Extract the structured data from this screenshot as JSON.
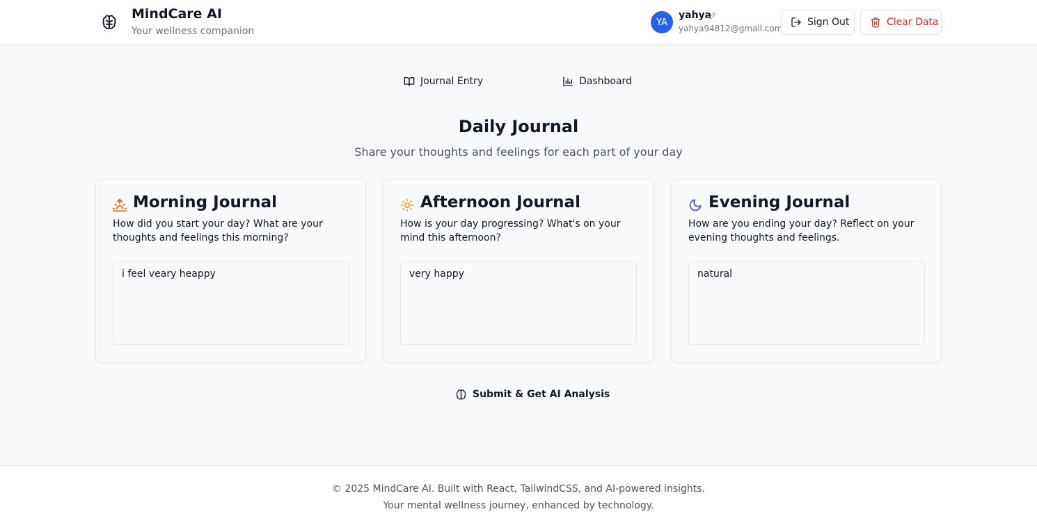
{
  "header": {
    "brand_title": "MindCare AI",
    "brand_subtitle": "Your wellness companion",
    "brand_icon": "brain-icon",
    "user": {
      "initials": "YA",
      "name": "yahya",
      "email": "yahya94812@gmail.com"
    },
    "sign_out_label": "Sign Out",
    "clear_data_label": "Clear Data"
  },
  "tabs": [
    {
      "label": "Journal Entry",
      "icon": "book-icon"
    },
    {
      "label": "Dashboard",
      "icon": "bar-chart-icon"
    }
  ],
  "main": {
    "title": "Daily Journal",
    "subtitle": "Share your thoughts and feelings for each part of your day",
    "cards": [
      {
        "title": "Morning Journal",
        "icon": "sunrise-icon",
        "prompt": "How did you start your day? What are your thoughts and feelings this morning?",
        "value": "i feel veary heappy"
      },
      {
        "title": "Afternoon Journal",
        "icon": "sun-icon",
        "prompt": "How is your day progressing? What's on your mind this afternoon?",
        "value": "very happy"
      },
      {
        "title": "Evening Journal",
        "icon": "moon-icon",
        "prompt": "How are you ending your day? Reflect on your evening thoughts and feelings.",
        "value": "natural"
      }
    ],
    "submit_label": "Submit & Get AI Analysis"
  },
  "footer": {
    "line1": "© 2025 MindCare AI. Built with React, TailwindCSS, and AI-powered insights.",
    "line2": "Your mental wellness journey, enhanced by technology."
  },
  "colors": {
    "primary_avatar": "#2563eb",
    "danger": "#dc2626",
    "sunrise": "#ea580c",
    "sun": "#f59e0b",
    "moon": "#4f46e5"
  }
}
